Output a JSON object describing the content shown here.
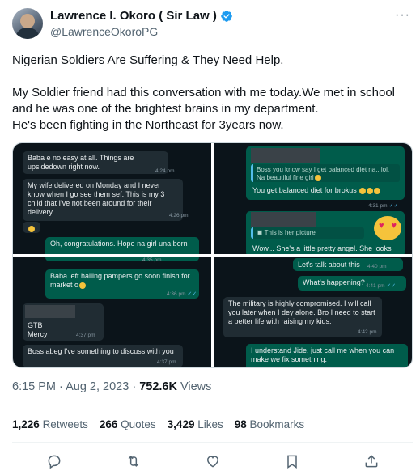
{
  "author": {
    "name": "Lawrence I. Okoro ( Sir Law )",
    "handle": "@LawrenceOkoroPG",
    "more_icon": "more-horizontal-icon",
    "verified_color": "#1d9bf0"
  },
  "tweet": {
    "line1": "Nigerian Soldiers Are Suffering & They Need Help.",
    "line2": "My Soldier friend had this conversation with me today.We met in school and he was one of the brightest brains in my department.",
    "line3": "He's been fighting in the Northeast for 3years now."
  },
  "chat": {
    "p1": {
      "m1": "Baba e no easy at all. Things are upsidedown right now.",
      "m1_time": "4:24 pm",
      "m2": "My wife delivered on Monday and I never know when I go see them sef. This is my 3 child that I've not been around for their delivery.",
      "m2_time": "4:26 pm",
      "m3": "Oh, congratulations. Hope na girl una born"
    },
    "p2": {
      "q1": "Boss you know say I get balanced diet na.. lol. Na beautiful fine girl",
      "m1": "You get balanced diet for brokus",
      "m1_time": "4:31 pm",
      "q2": "This is her picture",
      "m2": "Wow... She's a little pretty angel. She looks"
    },
    "p3": {
      "m0_time": "4:35 pm",
      "m1": "Baba left hailing pampers go soon finish for market o",
      "m1_time": "4:36 pm",
      "m2a": "GTB",
      "m2b": "Mercy",
      "m2_time": "4:37 pm",
      "m3": "Boss abeg I've something to discuss with you",
      "m3_time": "4:37 pm"
    },
    "p4": {
      "m1": "Let's talk about this",
      "m1_time": "4:40 pm",
      "m2": "What's happening?",
      "m2_time": "4:41 pm",
      "m3": "The military is highly compromised. I will call you later when I dey alone. Bro I need to start a better life with raising my kids.",
      "m3_time": "4:42 pm",
      "m4": "I understand Jide, just call me when you can make we fix something."
    }
  },
  "meta": {
    "datetime": "6:15 PM · Aug 2, 2023 · ",
    "views_count": "752.6K",
    "views_label": " Views"
  },
  "stats": {
    "retweets_count": "1,226",
    "retweets_label": "Retweets",
    "quotes_count": "266",
    "quotes_label": "Quotes",
    "likes_count": "3,429",
    "likes_label": "Likes",
    "bookmarks_count": "98",
    "bookmarks_label": "Bookmarks"
  },
  "actions": [
    "reply-icon",
    "retweet-icon",
    "like-icon",
    "bookmark-icon",
    "share-icon"
  ]
}
